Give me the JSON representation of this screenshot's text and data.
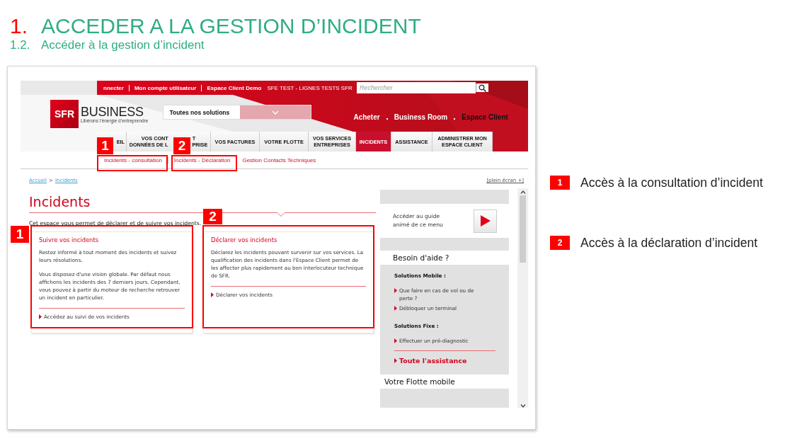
{
  "slide": {
    "number": "1.",
    "title": "ACCEDER A LA GESTION D’INCIDENT",
    "subtitle_number": "1.2.",
    "subtitle": "Accéder à la gestion d’incident"
  },
  "site": {
    "top_links": [
      "nnecter",
      "Mon compte utilisateur",
      "Espace Client Demo"
    ],
    "account": "SFE TEST - LIGNES TESTS SFR",
    "search": {
      "placeholder": "Rechercher"
    },
    "logo": {
      "mark": "SFR",
      "name": "BUSINESS",
      "tagline": "Libérons l’énergie d’entreprendre"
    },
    "solutions_dropdown": {
      "value": "Toutes nos solutions"
    },
    "header_links": [
      {
        "label": "Acheter",
        "selected": false
      },
      {
        "label": "Business Room",
        "selected": false
      },
      {
        "label": "Espace Client",
        "selected": true
      }
    ],
    "nav": [
      {
        "lines": [
          [
            "EIL"
          ]
        ],
        "selected": false
      },
      {
        "lines": [
          [
            "VOS CONT",
            "T"
          ],
          [
            "DONNÉES DE L",
            "PRISE"
          ]
        ],
        "selected": false
      },
      {
        "lines": [
          [
            "VOS FACTURES"
          ]
        ],
        "selected": false
      },
      {
        "lines": [
          [
            "VOTRE FLOTTE"
          ]
        ],
        "selected": false
      },
      {
        "lines": [
          [
            "VOS SERVICES"
          ],
          [
            "ENTREPRISES"
          ]
        ],
        "selected": false
      },
      {
        "lines": [
          [
            "INCIDENTS"
          ]
        ],
        "selected": true
      },
      {
        "lines": [
          [
            "ASSISTANCE"
          ]
        ],
        "selected": false
      },
      {
        "lines": [
          [
            "ADMINISTRER MON"
          ],
          [
            "ESPACE CLIENT"
          ]
        ],
        "selected": false
      }
    ],
    "subnav": [
      "Incidents - consultation",
      "Incidents - Déclaration",
      "Gestion Contacts Techniques"
    ],
    "breadcrumb": {
      "items": [
        "Accueil",
        "Incidents"
      ],
      "separator": ">"
    },
    "fullscreen_link": "[plein écran +]",
    "page_title": "Incidents",
    "intro": "Cet espace vous permet de déclarer et de suivre vos incidents.",
    "cards": [
      {
        "title": "Suivre vos incidents",
        "paragraphs": [
          "Restez informé à tout moment des incidents et suivez leurs résolutions.",
          "Vous disposez d'une vision globale. Par défaut nous affichons les incidents des 7 derniers jours. Cependant, vous pouvez à partir du moteur de recherche retrouver un incident en particulier."
        ],
        "link": "Accédez au suivi de vos incidents"
      },
      {
        "title": "Déclarer vos incidents",
        "paragraphs": [
          "Déclarez les incidents pouvant survenir sur vos services. La qualification des incidents dans l'Espace Client permet de les affecter plus rapidement au bon interlocuteur technique de SFR."
        ],
        "link": "Déclarer vos incidents"
      }
    ],
    "sidebar": {
      "guide": "Accéder au guide animé de ce menu",
      "help_title": "Besoin d'aide ?",
      "sections": [
        {
          "heading": "Solutions Mobile :",
          "links": [
            "Que faire en cas de vol ou de perte ?",
            "Débloquer un terminal"
          ]
        },
        {
          "heading": "Solutions Fixe :",
          "links": [
            "Effectuer un pré-diagnostic"
          ]
        }
      ],
      "all_link": "Toute l'assistance",
      "fleet_title": "Votre Flotte mobile"
    }
  },
  "markers": [
    {
      "number": "1"
    },
    {
      "number": "2"
    },
    {
      "number": "1"
    },
    {
      "number": "2"
    }
  ],
  "annotations": [
    {
      "number": "1",
      "text": "Accès à la consultation d’incident"
    },
    {
      "number": "2",
      "text": "Accès à la déclaration d’incident"
    }
  ]
}
